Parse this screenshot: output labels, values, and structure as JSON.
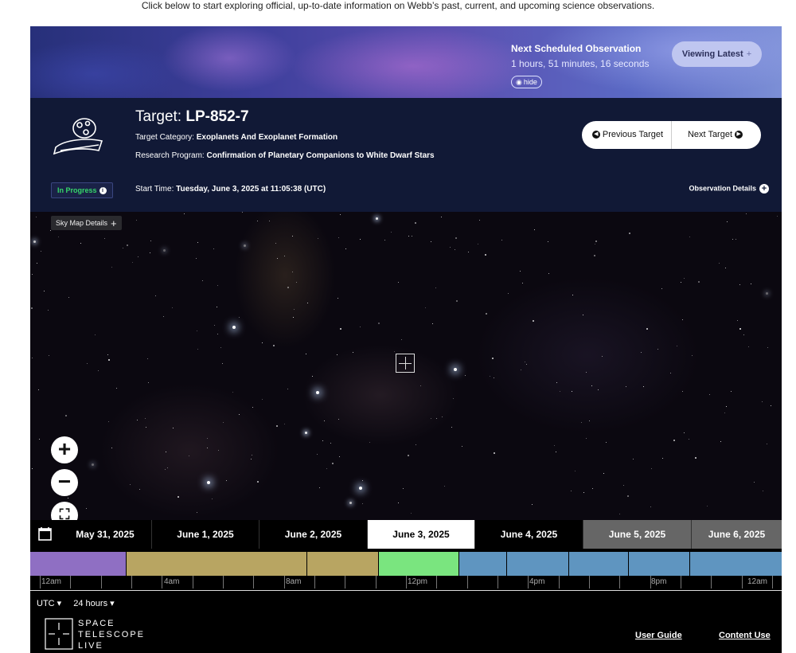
{
  "intro": "Click below to start exploring official, up-to-date information on Webb’s past, current, and upcoming science observations.",
  "banner": {
    "next_title": "Next Scheduled Observation",
    "next_time": "1 hours, 51 minutes, 16 seconds",
    "hide_label": "hide",
    "viewing_latest": "Viewing Latest"
  },
  "target": {
    "prefix": "Target: ",
    "name": "LP-852-7",
    "category_label": "Target Category: ",
    "category": "Exoplanets And Exoplanet Formation",
    "program_label": "Research Program: ",
    "program": "Confirmation of Planetary Companions to White Dwarf Stars",
    "status": "In Progress",
    "start_label": "Start Time: ",
    "start_time": "Tuesday, June 3, 2025 at 11:05:38 (UTC)",
    "prev": "Previous Target",
    "next": "Next Target",
    "details": "Observation Details"
  },
  "sky": {
    "details_label": "Sky Map Details"
  },
  "dates": [
    "May 31, 2025",
    "June 1, 2025",
    "June 2, 2025",
    "June 3, 2025",
    "June 4, 2025",
    "June 5, 2025",
    "June 6, 2025"
  ],
  "timeline_labels": [
    "12am",
    "4am",
    "8am",
    "12pm",
    "4pm",
    "8pm",
    "12am"
  ],
  "footer": {
    "timezone": "UTC",
    "range": "24 hours",
    "brand": [
      "SPACE",
      "TELESCOPE",
      "LIVE"
    ],
    "user_guide": "User Guide",
    "content_use": "Content Use"
  },
  "colors": {
    "past_purple": "#8f6fc3",
    "past_gold": "#b8a562",
    "current_green": "#7ae57f",
    "future_blue": "#5f95c0"
  }
}
